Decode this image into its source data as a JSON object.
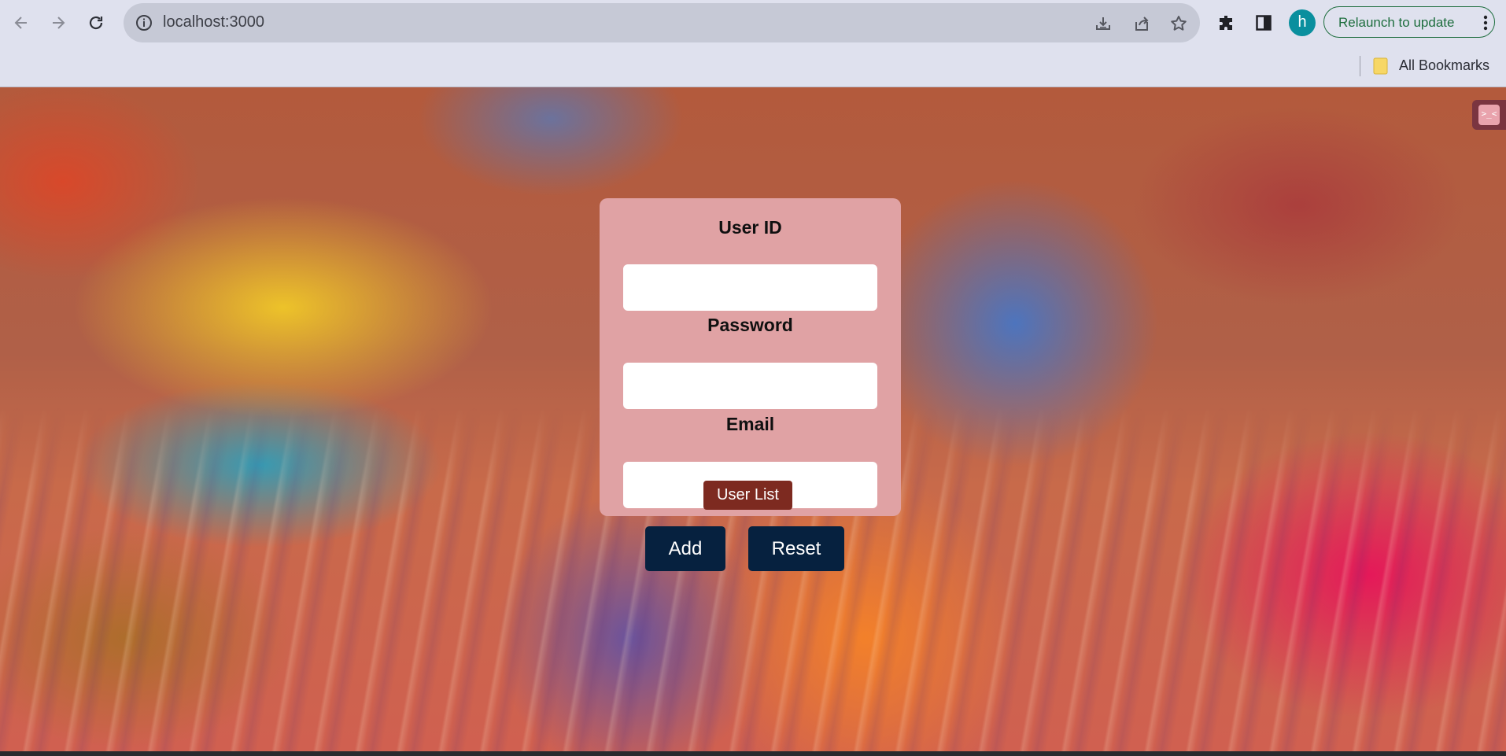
{
  "browser": {
    "url": "localhost:3000",
    "profile_initial": "h",
    "relaunch_label": "Relaunch to update",
    "bookmarks_label": "All Bookmarks",
    "icons": [
      "back-arrow-icon",
      "forward-arrow-icon",
      "reload-icon",
      "site-info-icon",
      "install-app-icon",
      "share-icon",
      "star-icon",
      "extensions-icon",
      "side-panel-icon",
      "kebab-menu-icon",
      "bookmark-folder-icon"
    ]
  },
  "page": {
    "extension_badge": ">_<",
    "form": {
      "user_id_label": "User ID",
      "password_label": "Password",
      "email_label": "Email",
      "user_id_value": "",
      "password_value": "",
      "email_value": "",
      "add_label": "Add",
      "reset_label": "Reset"
    },
    "user_list_label": "User List"
  },
  "colors": {
    "card": "#e0a2a4",
    "button": "#06213f",
    "user_list": "#7d2a20",
    "relaunch_accent": "#1e6e3e",
    "avatar": "#0a8f9e"
  }
}
